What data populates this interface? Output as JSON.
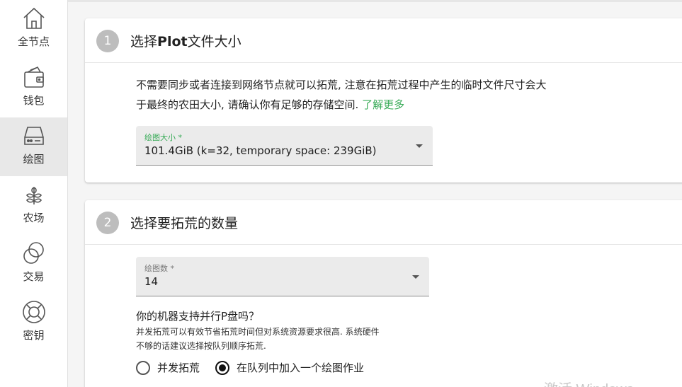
{
  "sidebar": {
    "items": [
      {
        "label": "全节点",
        "icon": "home-icon"
      },
      {
        "label": "钱包",
        "icon": "wallet-icon"
      },
      {
        "label": "绘图",
        "icon": "hard-drive-icon"
      },
      {
        "label": "农场",
        "icon": "plant-icon"
      },
      {
        "label": "交易",
        "icon": "exchange-circles-icon"
      },
      {
        "label": "密钥",
        "icon": "lifebuoy-icon"
      }
    ],
    "active_index": 2
  },
  "step1": {
    "number": "1",
    "title_prefix": "选择",
    "title_bold": "Plot",
    "title_suffix": "文件大小",
    "description_line1": "不需要同步或者连接到网络节点就可以拓荒, 注意在拓荒过程中产生的临时文件尺寸会大",
    "description_line2": "于最终的农田大小, 请确认你有足够的存储空间.",
    "learn_more": "了解更多",
    "select": {
      "label": "绘图大小 *",
      "value": "101.4GiB (k=32, temporary space: 239GiB)"
    }
  },
  "step2": {
    "number": "2",
    "title": "选择要拓荒的数量",
    "select": {
      "label": "绘图数 *",
      "value": "14"
    },
    "question": "你的机器支持并行P盘吗？",
    "hint_line1": "并发拓荒可以有效节省拓荒时间但对系统资源要求很高. 系统硬件",
    "hint_line2": "不够的话建议选择按队列顺序拓荒.",
    "radio_parallel": "并发拓荒",
    "radio_queue": "在队列中加入一个绘图作业",
    "selected": "queue"
  },
  "watermark": "激活 Windows",
  "colors": {
    "accent_green": "#3aac59",
    "step_circle": "#bdbdbd",
    "active_nav": "#e8e8e8"
  }
}
